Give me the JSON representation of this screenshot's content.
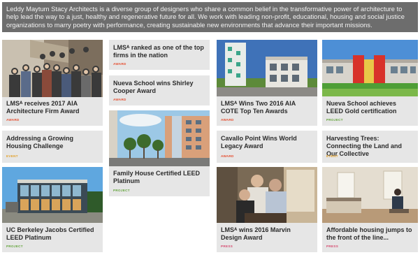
{
  "intro": "Leddy Maytum Stacy Architects is a diverse group of designers who share a common belief in the transformative power of architecture to help lead the way to a just, healthy and regenerative future for all. We work with leading non-profit, educational, housing and social justice organizations to marry poetry with performance, creating sustainable new environments that advance their important missions.",
  "colors": {
    "banner_bg": "#6d6d6d",
    "card_bg": "#e6e6e6",
    "tag_award": "#e54b2c",
    "tag_event": "#e2a02a",
    "tag_project": "#62a43a",
    "tag_press": "#d64b70"
  },
  "cards": [
    {
      "title": "LMSᴬ receives 2017 AIA Architecture Firm Award",
      "tag": "AWARD",
      "photo": "team-group-photo"
    },
    {
      "title": "Addressing a Growing Housing Challenge",
      "tag": "EVENT"
    },
    {
      "title": "UC Berkeley Jacobs Certified LEED Platinum",
      "tag": "PROJECT",
      "photo": "glass-building-photo"
    },
    {
      "title": "LMSᴬ ranked as one of the top firms in the nation",
      "tag": "AWARD"
    },
    {
      "title": "Nueva School wins Shirley Cooper Award",
      "tag": "AWARD"
    },
    {
      "title": "Family House Certified LEED Platinum",
      "tag": "PROJECT",
      "photo": "family-house-street-photo"
    },
    {
      "title": "LMSᴬ Wins Two 2016 AIA COTE Top Ten Awards",
      "tag": "AWARD",
      "photo": "housing-towers-photo"
    },
    {
      "title": "Cavallo Point Wins World Legacy Award",
      "tag": "AWARD"
    },
    {
      "title": "LMSᴬ wins 2016 Marvin Design Award",
      "tag": "PRESS",
      "photo": "architects-portrait-photo"
    },
    {
      "title": "Nueva School achieves LEED Gold certification",
      "tag": "PROJECT",
      "photo": "nueva-school-photo"
    },
    {
      "title": "Harvesting Trees: Connecting the Land and Our Collective",
      "tag": "EVENT"
    },
    {
      "title": "Affordable housing jumps to the front of the line...",
      "tag": "PRESS",
      "photo": "interior-room-photo"
    }
  ]
}
